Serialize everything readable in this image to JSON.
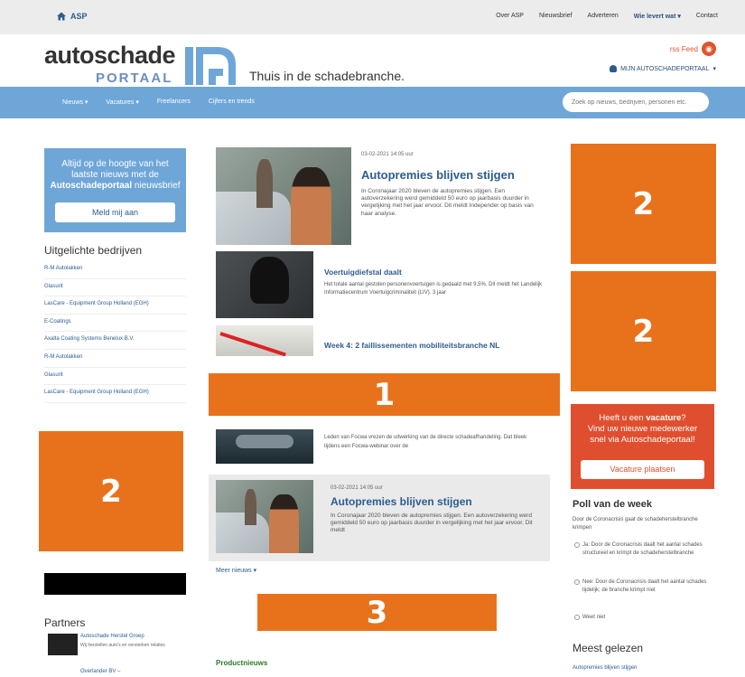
{
  "topbar": {
    "home_label": "ASP",
    "links": [
      "Over ASP",
      "Nieuwsbrief",
      "Adverteren",
      "Wie levert wat ▾",
      "Contact"
    ]
  },
  "header": {
    "logo_word": "autoschade",
    "logo_sub": "PORTAAL",
    "tagline": "Thuis in de schadebranche.",
    "rss_label": "rss Feed",
    "account_label": "MIJN AUTOSCHADEPORTAAL"
  },
  "nav": {
    "items": [
      "Nieuws ▾",
      "Vacatures ▾",
      "Freelancers",
      "Cijfers en trends"
    ],
    "search_placeholder": "Zoek op nieuws, bedrijven, personen etc."
  },
  "newsletter": {
    "line1": "Altijd op de hoogte van het",
    "line2": "laatste nieuws met de",
    "line3_bold": "Autoschadeportaal",
    "line3_rest": " nieuwsbrief",
    "button": "Meld mij aan"
  },
  "featured": {
    "title": "Uitgelichte bedrijven",
    "items": [
      "R-M Autolakken",
      "Glasurit",
      "LasCare - Equipment Group Holland (EGH)",
      "E-Coatings",
      "Axalta Coating Systems Benelux B.V.",
      "R-M Autolakken",
      "Glasurit",
      "LasCare - Equipment Group Holland (EGH)"
    ]
  },
  "ads": {
    "left": "2",
    "right_top": "2",
    "right_mid": "2",
    "center_1": "1",
    "center_3": "3"
  },
  "partners": {
    "title": "Partners",
    "items": [
      {
        "name": "Autoschade Herstel Groep",
        "desc": "Wij herstellen auto's en versterken relaties"
      },
      {
        "name": "Overlander BV –",
        "desc": ""
      }
    ]
  },
  "articles": [
    {
      "date": "03-02-2021  14:05 uur",
      "title": "Autopremies blijven stijgen",
      "text": "In Coronajaar 2020 bleven de autopremies stijgen. Een autoverzekering werd gemiddeld 50 euro op jaarbasis duurder in vergelijking met het jaar ervoor. Dit meldt Independer op basis van haar analyse."
    },
    {
      "date": "",
      "title": "Voertuigdiefstal daalt",
      "text": "Het totale aantal gestolen personenvoertuigen is gedaald met 9,5%. Dit meldt het Landelijk Informatiecentrum Voertuigcriminaliteit (LIV). 3 jaar"
    },
    {
      "date": "",
      "title": "Week 4: 2 faillissementen mobiliteitsbranche NL",
      "text": ""
    },
    {
      "date": "",
      "title": "",
      "text": "Leden van Focwa vrezen de uitwerking van de directe schadeafhandeling. Dat bleek tijdens een Focwa-webinar over de"
    },
    {
      "date": "03-02-2021  14:05 uur",
      "title": "Autopremies blijven stijgen",
      "text": "In Coronajaar 2020 bleven de autopremies stijgen. Een autoverzekering werd gemiddeld 50 euro op jaarbasis duurder in vergelijking met het jaar ervoor. Dit meldt"
    }
  ],
  "meer_nieuws": "Meer nieuws ▾",
  "productnieuws": "Productnieuws",
  "vacature": {
    "line1_pre": "Heeft u een ",
    "line1_bold": "vacature",
    "line1_post": "?",
    "line2": "Vind uw nieuwe medewerker",
    "line3": "snel via Autoschadeportaal!",
    "button": "Vacature plaatsen"
  },
  "poll": {
    "title": "Poll van de week",
    "question": "Door de Coronacrisis gaat de schadeherstelbranche krimpen",
    "options": [
      "Ja: Door de Coronacrisis daalt het aantal schades structureel en krimpt de schadeherstelbranche",
      "Nee: Door de Coronacrisis daalt het aantal schades tijdelijk; de branche krimpt niet",
      "Weet niet"
    ]
  },
  "meest": {
    "title": "Meest gelezen",
    "items": [
      "Autopremies blijven stijgen"
    ]
  },
  "colors": {
    "primary_blue": "#6fa6d8",
    "ad_orange": "#e8721c",
    "vacature_red": "#df4f2f",
    "link_blue": "#2d5c8f"
  }
}
